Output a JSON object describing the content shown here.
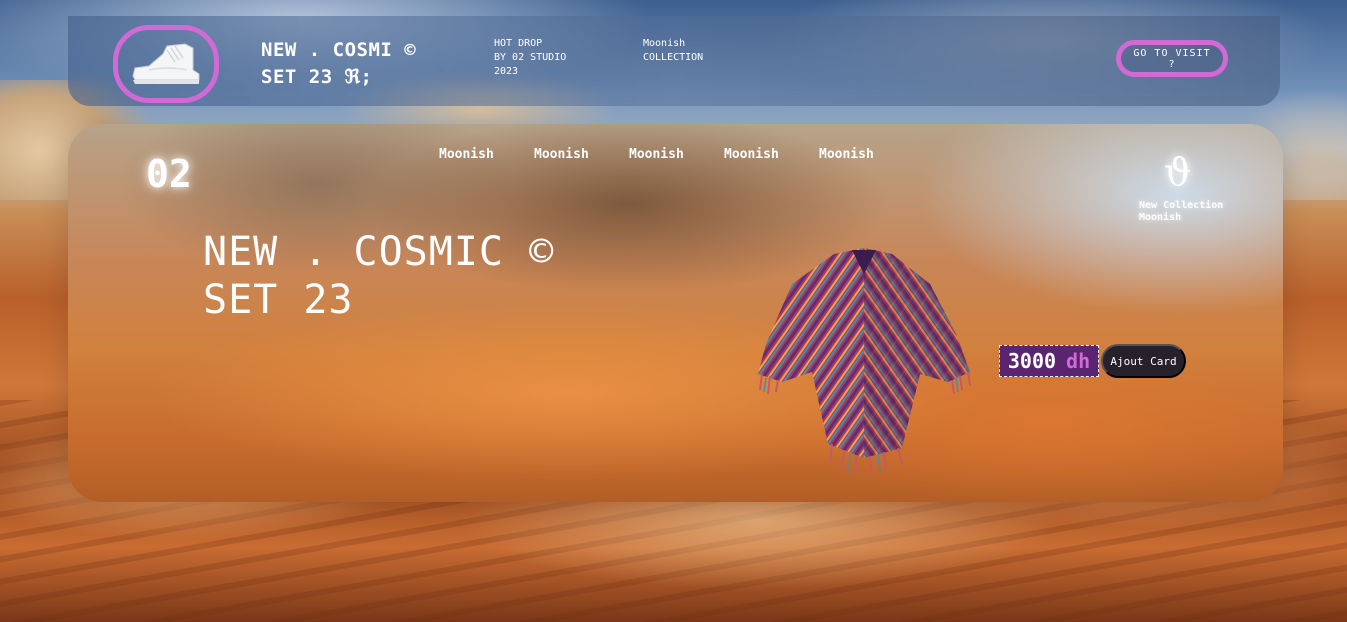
{
  "header": {
    "title_line1": "NEW . COSMI ©",
    "title_line2": "SET 23 ℜ;",
    "hot_drop": [
      "HOT DROP",
      "BY 02 STUDIO",
      "2023"
    ],
    "collection": [
      "Moonish",
      "COLLECTION"
    ],
    "visit_label": "GO TO VISIT ?"
  },
  "card": {
    "number": "02",
    "nav": [
      "Moonish",
      "Moonish",
      "Moonish",
      "Moonish",
      "Moonish"
    ],
    "symbol": "ϑ",
    "new_collection": [
      "New Collection",
      "Moonish"
    ],
    "title_line1": "NEW . COSMIC ©",
    "title_line2": "SET 23",
    "price_amount": "3000",
    "price_currency": "dh",
    "cart_label": "Ajout Card"
  },
  "colors": {
    "accent": "#d26ad6",
    "price_bg": "#5a2470",
    "cart_bg": "#26212a"
  },
  "icons": {
    "logo": "sneaker-icon",
    "product": "poncho-image"
  }
}
